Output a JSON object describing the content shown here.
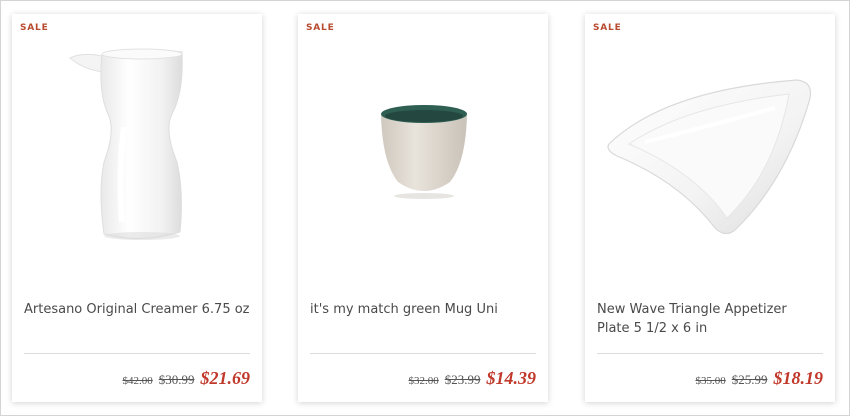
{
  "products": [
    {
      "badge": "SALE",
      "name": "Artesano Original Creamer 6.75 oz",
      "price_original": "$42.00",
      "price_was": "$30.99",
      "price_sale": "$21.69"
    },
    {
      "badge": "SALE",
      "name": "it's my match green Mug Uni",
      "price_original": "$32.00",
      "price_was": "$23.99",
      "price_sale": "$14.39"
    },
    {
      "badge": "SALE",
      "name": "New Wave Triangle Appetizer Plate 5 1/2 x 6 in",
      "price_original": "$35.00",
      "price_was": "$25.99",
      "price_sale": "$18.19"
    }
  ],
  "colors": {
    "sale_badge": "#b84a2e",
    "sale_price": "#c0392b",
    "mug_interior": "#2f5e52",
    "mug_exterior": "#e2dcd3"
  }
}
